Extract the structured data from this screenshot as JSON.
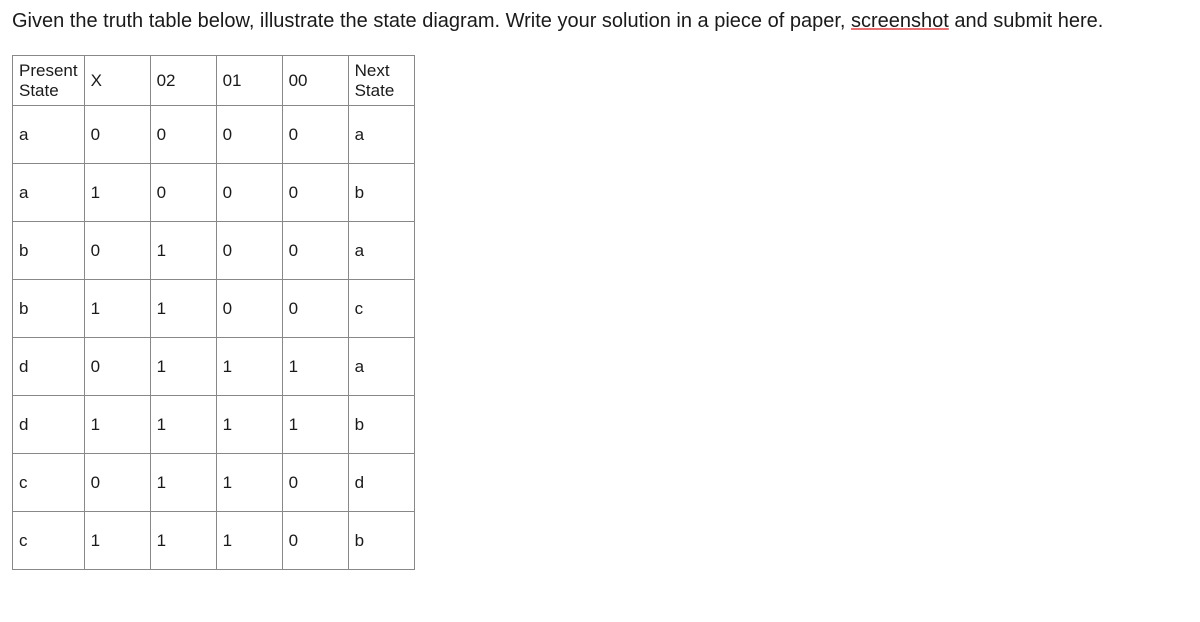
{
  "prompt": {
    "part1": "Given the truth table below, illustrate the state diagram. Write your solution in a piece of paper, ",
    "highlight": "screenshot",
    "part2": " and submit here."
  },
  "table": {
    "headers": [
      "Present State",
      "X",
      "02",
      "01",
      "00",
      "Next State"
    ],
    "rows": [
      [
        "a",
        "0",
        "0",
        "0",
        "0",
        "a"
      ],
      [
        "a",
        "1",
        "0",
        "0",
        "0",
        "b"
      ],
      [
        "b",
        "0",
        "1",
        "0",
        "0",
        "a"
      ],
      [
        "b",
        "1",
        "1",
        "0",
        "0",
        "c"
      ],
      [
        "d",
        "0",
        "1",
        "1",
        "1",
        "a"
      ],
      [
        "d",
        "1",
        "1",
        "1",
        "1",
        "b"
      ],
      [
        "c",
        "0",
        "1",
        "1",
        "0",
        "d"
      ],
      [
        "c",
        "1",
        "1",
        "1",
        "0",
        "b"
      ]
    ]
  },
  "chart_data": {
    "type": "table",
    "title": "State transition truth table",
    "columns": [
      "Present State",
      "X",
      "02",
      "01",
      "00",
      "Next State"
    ],
    "data": [
      {
        "present_state": "a",
        "x": 0,
        "o2": 0,
        "o1": 0,
        "o0": 0,
        "next_state": "a"
      },
      {
        "present_state": "a",
        "x": 1,
        "o2": 0,
        "o1": 0,
        "o0": 0,
        "next_state": "b"
      },
      {
        "present_state": "b",
        "x": 0,
        "o2": 1,
        "o1": 0,
        "o0": 0,
        "next_state": "a"
      },
      {
        "present_state": "b",
        "x": 1,
        "o2": 1,
        "o1": 0,
        "o0": 0,
        "next_state": "c"
      },
      {
        "present_state": "d",
        "x": 0,
        "o2": 1,
        "o1": 1,
        "o0": 1,
        "next_state": "a"
      },
      {
        "present_state": "d",
        "x": 1,
        "o2": 1,
        "o1": 1,
        "o0": 1,
        "next_state": "b"
      },
      {
        "present_state": "c",
        "x": 0,
        "o2": 1,
        "o1": 1,
        "o0": 0,
        "next_state": "d"
      },
      {
        "present_state": "c",
        "x": 1,
        "o2": 1,
        "o1": 1,
        "o0": 0,
        "next_state": "b"
      }
    ]
  }
}
